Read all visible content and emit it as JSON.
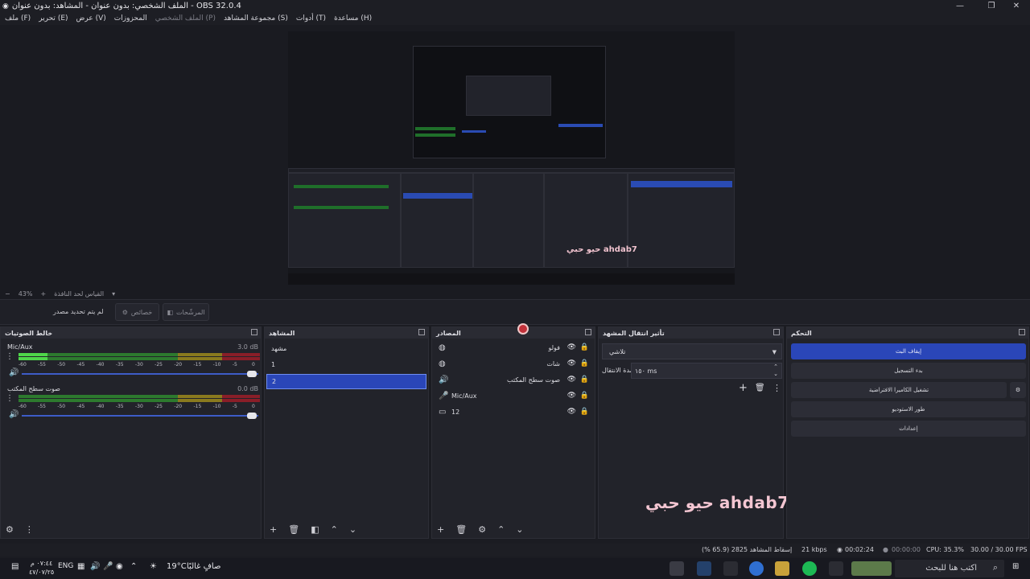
{
  "window": {
    "title": "الملف الشخصي: بدون عنوان - المشاهد: بدون عنوان - OBS 32.0.4",
    "minimize": "—",
    "maximize": "❐",
    "close": "✕"
  },
  "menu": {
    "items": [
      "ملف (F)",
      "تحرير (E)",
      "عرض (V)",
      "المحزوزات",
      "الملف الشخصي (P)",
      "مجموعة المشاهد (S)",
      "أدوات (T)",
      "مساعدة (H)"
    ]
  },
  "zoom": {
    "minus": "−",
    "value": "43%",
    "plus": "+",
    "fit_label": "القياس لحد النافذة"
  },
  "source_toolbar": {
    "no_source": "لم يتم تحديد مصدر",
    "properties": "خصائص",
    "filters": "المرشّحات"
  },
  "preview": {
    "watermark": "حيو حبي  ahdab7"
  },
  "audio_mixer": {
    "title": "خالط الصوتيات",
    "channels": [
      {
        "name": "Mic/Aux",
        "db": "3.0 dB",
        "level": 0.12
      },
      {
        "name": "صوت سطح المكتب",
        "db": "0.0 dB",
        "level": 0.0
      }
    ],
    "ticks": [
      "-60",
      "-55",
      "-50",
      "-45",
      "-40",
      "-35",
      "-30",
      "-25",
      "-20",
      "-15",
      "-10",
      "-5",
      "0"
    ]
  },
  "scenes": {
    "title": "المشاهد",
    "items": [
      "مشهد",
      "1",
      "2"
    ],
    "selected_index": 2
  },
  "sources": {
    "title": "المصادر",
    "items": [
      {
        "name": "فولو",
        "icon": "globe-icon"
      },
      {
        "name": "شات",
        "icon": "globe-icon"
      },
      {
        "name": "صوت سطح المكتب",
        "icon": "speaker-icon"
      },
      {
        "name": "Mic/Aux",
        "icon": "microphone-icon"
      },
      {
        "name": "12",
        "icon": "monitor-icon"
      }
    ]
  },
  "transitions": {
    "title": "تأثير انتقال المشهد",
    "selected": "تلاشي",
    "duration_label": "مدة الانتقال",
    "duration_value": "١٥٠ ms"
  },
  "controls": {
    "title": "التحكم",
    "buttons": [
      "إيقاف البث",
      "بدء التسجيل",
      "تشغيل الكاميرا الافتراضية",
      "طور الاستوديو",
      "إعدادات"
    ]
  },
  "watermark": "حيو حبي  ahdab7",
  "status": {
    "dropped": "إسقاط المشاهد 2825 (65.9 %)",
    "bitrate": "21 kbps",
    "stream_time": "00:02:24",
    "record_time": "00:00:00",
    "cpu": "CPU: 35.3%",
    "fps": "30.00 / 30.00 FPS"
  },
  "taskbar": {
    "time": "٠٧:٤٤ م",
    "date": "٤٧/٠٧/٢٥",
    "lang": "ENG",
    "weather_temp": "19°C",
    "weather_text": "صافٍ غالبًا",
    "search_placeholder": "اكتب هنا للبحث"
  }
}
